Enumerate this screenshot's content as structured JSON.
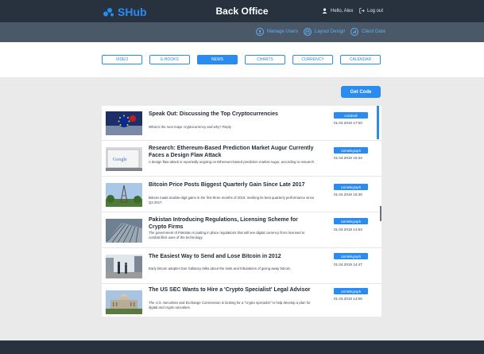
{
  "header": {
    "logo_text": "SHub",
    "title": "Back Office",
    "user_greeting": "Hello, Alex",
    "logout_label": "Log out",
    "accent": "#2a8cf0"
  },
  "subnav": [
    {
      "label": "Manage Users",
      "icon": "users-icon"
    },
    {
      "label": "Layout Design",
      "icon": "layout-icon"
    },
    {
      "label": "Client Data",
      "icon": "data-icon"
    }
  ],
  "tabs": [
    {
      "label": "VIDEO",
      "active": false
    },
    {
      "label": "E-BOOKS",
      "active": false
    },
    {
      "label": "NEWS",
      "active": true
    },
    {
      "label": "CHARTS",
      "active": false
    },
    {
      "label": "CURRENCY",
      "active": false
    },
    {
      "label": "CALENDAR",
      "active": false
    }
  ],
  "get_code_label": "Get Code",
  "news": [
    {
      "title": "Speak Out: Discussing the Top Cryptocurrencies",
      "desc": "What is the next major cryptocurrency and why? Reply",
      "badge": "coindesk",
      "date": "01.04.2019 17:00",
      "thumb": "eu-flag-image"
    },
    {
      "title": "Research: Ethereum-Based Prediction Market Augur Currently Faces a Design Flaw Attack",
      "desc": "A design flaw attack is reportedly ongoing on Ethereum-based prediction market Augur, according to research",
      "badge": "cointelegraph",
      "date": "01.04.2019 16:34",
      "thumb": "google-laptop-image"
    },
    {
      "title": "Bitcoin Price Posts Biggest Quarterly Gain Since Late 2017",
      "desc": "Bitcoin made double-digit gains in the first three months of 2019, marking its best quarterly performance since Q4 2017.",
      "badge": "cointelegraph",
      "date": "01.04.2019 15:30",
      "thumb": "eiffel-tower-image"
    },
    {
      "title": "Pakistan Introducing Regulations, Licensing Scheme for Crypto Firms",
      "desc": "The government of Pakistan is putting in place regulations that will see digital currency firms licensed to combat illicit uses of the technology.",
      "badge": "cointelegraph",
      "date": "01.04.2019 14:53",
      "thumb": "architecture-image"
    },
    {
      "title": "The Easiest Way to Send and Lose Bitcoin in 2012",
      "desc": "Early bitcoin adopter Dan Gallancy talks about the trials and tribulations of giving away bitcoin.",
      "badge": "cointelegraph",
      "date": "01.04.2019 14:47",
      "thumb": "street-image"
    },
    {
      "title": "The US SEC Wants to Hire a 'Crypto Specialist' Legal Advisor",
      "desc": "The U.S. Securities and Exchange Commission is looking for a \"crypto specialist\" to help develop a plan for digital and crypto securities.",
      "badge": "cointelegraph",
      "date": "01.04.2019 14:06",
      "thumb": "capitol-image"
    }
  ]
}
